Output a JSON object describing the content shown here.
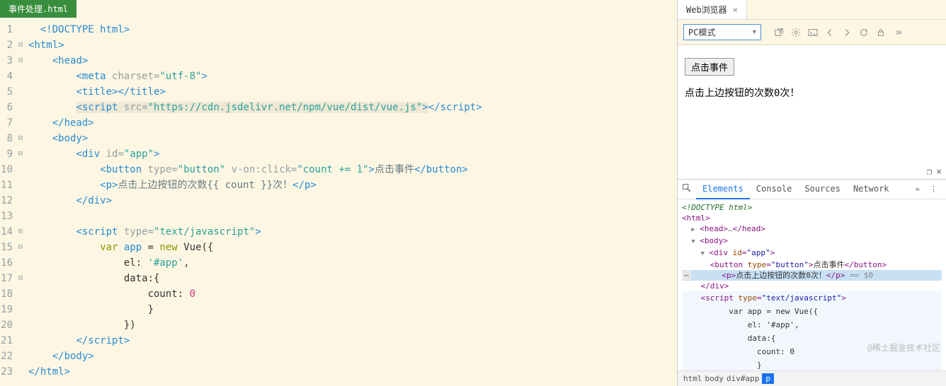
{
  "editor": {
    "tab": "事件处理.html",
    "lines": [
      {
        "n": 1,
        "fold": "",
        "html": "  <span class='p-tag'>&lt;!DOCTYPE html&gt;</span>"
      },
      {
        "n": 2,
        "fold": "⊟",
        "html": "<span class='p-tag'>&lt;html&gt;</span>"
      },
      {
        "n": 3,
        "fold": "⊟",
        "html": "    <span class='p-tag'>&lt;head&gt;</span>"
      },
      {
        "n": 4,
        "fold": "",
        "html": "        <span class='p-tag'>&lt;meta</span> <span class='p-attr'>charset=</span><span class='p-str'>\"utf-8\"</span><span class='p-tag'>&gt;</span>"
      },
      {
        "n": 5,
        "fold": "",
        "html": "        <span class='p-tag'>&lt;title&gt;&lt;/title&gt;</span>"
      },
      {
        "n": 6,
        "fold": "",
        "html": "        <span class='hl'><span class='p-tag'>&lt;script</span> <span class='p-attr'>src=</span><span class='p-str'>\"https://cdn.jsdelivr.net/npm/vue/dist/vue.js\"</span><span class='p-tag'>&gt;</span></span><span class='p-tag'>&lt;/script&gt;</span>"
      },
      {
        "n": 7,
        "fold": "",
        "html": "    <span class='p-tag'>&lt;/head&gt;</span>"
      },
      {
        "n": 8,
        "fold": "⊟",
        "html": "    <span class='p-tag'>&lt;body&gt;</span>"
      },
      {
        "n": 9,
        "fold": "⊟",
        "html": "        <span class='p-tag'>&lt;div</span> <span class='p-attr'>id=</span><span class='p-str'>\"app\"</span><span class='p-tag'>&gt;</span>"
      },
      {
        "n": 10,
        "fold": "",
        "html": "            <span class='p-tag'>&lt;button</span> <span class='p-attr'>type=</span><span class='p-str'>\"button\"</span> <span class='p-attr'>v-on:click=</span><span class='p-str'>\"count += 1\"</span><span class='p-tag'>&gt;</span><span class='p-txt'>点击事件</span><span class='p-tag'>&lt;/button&gt;</span>"
      },
      {
        "n": 11,
        "fold": "",
        "html": "            <span class='p-tag'>&lt;p&gt;</span><span class='p-txt'>点击上边按钮的次数{{ count }}次！</span><span class='p-tag'>&lt;/p&gt;</span>"
      },
      {
        "n": 12,
        "fold": "",
        "html": "        <span class='p-tag'>&lt;/div&gt;</span>"
      },
      {
        "n": 13,
        "fold": "",
        "html": ""
      },
      {
        "n": 14,
        "fold": "⊟",
        "html": "        <span class='p-tag'>&lt;script</span> <span class='p-attr'>type=</span><span class='p-str'>\"text/javascript\"</span><span class='p-tag'>&gt;</span>"
      },
      {
        "n": 15,
        "fold": "⊟",
        "html": "            <span class='p-kw'>var</span> <span class='p-var'>app</span> = <span class='p-kw'>new</span> Vue({"
      },
      {
        "n": 16,
        "fold": "",
        "html": "                el: <span class='p-str'>'#app'</span>,"
      },
      {
        "n": 17,
        "fold": "⊟",
        "html": "                data:{"
      },
      {
        "n": 18,
        "fold": "",
        "html": "                    count: <span class='p-num'>0</span>"
      },
      {
        "n": 19,
        "fold": "",
        "html": "                    }"
      },
      {
        "n": 20,
        "fold": "",
        "html": "                })"
      },
      {
        "n": 21,
        "fold": "",
        "html": "        <span class='p-tag'>&lt;/script&gt;</span>"
      },
      {
        "n": 22,
        "fold": "",
        "html": "    <span class='p-tag'>&lt;/body&gt;</span>"
      },
      {
        "n": 23,
        "fold": "",
        "html": "<span class='p-tag'>&lt;/html&gt;</span>"
      }
    ]
  },
  "browser": {
    "tab_label": "Web浏览器",
    "mode": "PC模式",
    "preview_button": "点击事件",
    "preview_text": "点击上边按钮的次数0次！"
  },
  "devtools": {
    "tabs": [
      "Elements",
      "Console",
      "Sources",
      "Network"
    ],
    "active_tab": "Elements",
    "dom": [
      {
        "indent": 0,
        "html": "<span class='dt-cmt'>&lt;!DOCTYPE html&gt;</span>"
      },
      {
        "indent": 0,
        "html": "<span class='dt-tag'>&lt;html&gt;</span>"
      },
      {
        "indent": 1,
        "arrow": "▶",
        "html": "<span class='dt-tag'>&lt;head&gt;</span><span class='dt-gray'>…</span><span class='dt-tag'>&lt;/head&gt;</span>"
      },
      {
        "indent": 1,
        "arrow": "▼",
        "html": "<span class='dt-tag'>&lt;body&gt;</span>"
      },
      {
        "indent": 2,
        "arrow": "▼",
        "html": "<span class='dt-tag'>&lt;div <span class='dt-attr'>id</span>=<span class='dt-val'>\"app\"</span>&gt;</span>"
      },
      {
        "indent": 3,
        "html": "<span class='dt-tag'>&lt;button <span class='dt-attr'>type</span>=<span class='dt-val'>\"button\"</span>&gt;</span><span class='dt-txt'>点击事件</span><span class='dt-tag'>&lt;/button&gt;</span>"
      },
      {
        "indent": 3,
        "sel": true,
        "dots": true,
        "html": "<span class='dt-tag'>&lt;p&gt;</span><span class='dt-txt'>点击上边按钮的次数0次！</span><span class='dt-tag'>&lt;/p&gt;</span> <span class='dt-gray'>== $0</span>"
      },
      {
        "indent": 2,
        "html": "<span class='dt-tag'>&lt;/div&gt;</span>"
      },
      {
        "indent": 2,
        "script": true,
        "html": "<span class='dt-tag'>&lt;script <span class='dt-attr'>type</span>=<span class='dt-val'>\"text/javascript\"</span>&gt;</span>"
      },
      {
        "indent": 5,
        "script": true,
        "html": "<span class='dt-txt'>var app = new Vue({</span>"
      },
      {
        "indent": 7,
        "script": true,
        "html": "<span class='dt-txt'>el: '#app',</span>"
      },
      {
        "indent": 7,
        "script": true,
        "html": "<span class='dt-txt'>data:{</span>"
      },
      {
        "indent": 8,
        "script": true,
        "html": "<span class='dt-txt'>count: 0</span>"
      },
      {
        "indent": 8,
        "script": true,
        "html": "<span class='dt-txt'>}</span>"
      },
      {
        "indent": 7,
        "script": true,
        "html": "<span class='dt-txt'>})</span>"
      }
    ],
    "crumbs": [
      "html",
      "body",
      "div#app",
      "p"
    ],
    "watermark": "@稀土掘金技术社区"
  }
}
